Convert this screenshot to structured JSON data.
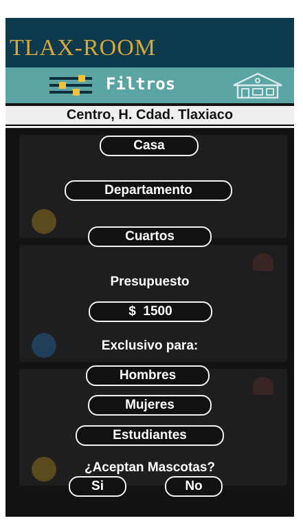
{
  "app": {
    "brand": "TLAX-ROOM",
    "colors": {
      "brand_bar": "#0d3a4d",
      "brand_text": "#d8a93a",
      "filter_bar": "#5aa4a4",
      "overlay": "#121212"
    }
  },
  "filter_bar": {
    "icon": "sliders-icon",
    "label": "Filtros",
    "home_icon": "house-icon"
  },
  "location": "Centro, H. Cdad. Tlaxiaco",
  "property_types": {
    "casa": "Casa",
    "departamento": "Departamento",
    "cuartos": "Cuartos"
  },
  "budget": {
    "title": "Presupuesto",
    "value": "$  1500"
  },
  "exclusive": {
    "title": "Exclusivo para:",
    "hombres": "Hombres",
    "mujeres": "Mujeres",
    "estudiantes": "Estudiantes"
  },
  "pets": {
    "question": "¿Aceptan Mascotas?",
    "yes": "Si",
    "no": "No"
  }
}
